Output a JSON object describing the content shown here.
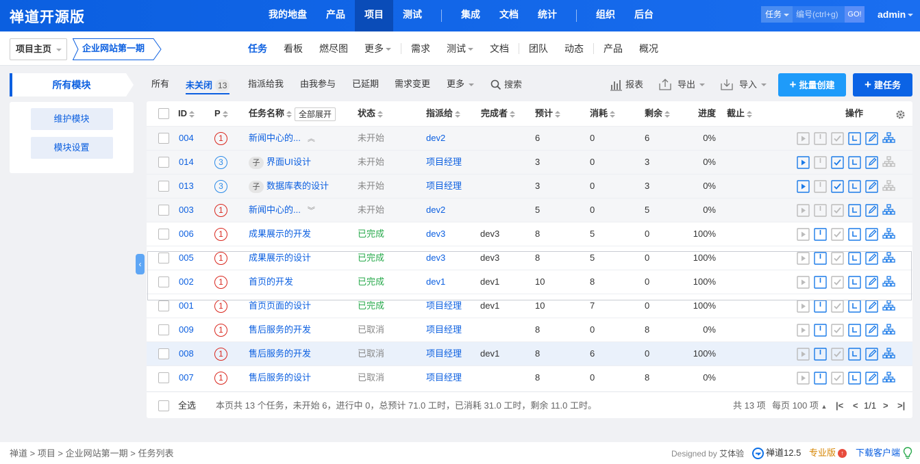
{
  "brand": "禅道开源版",
  "main_nav": [
    {
      "label": "我的地盘"
    },
    {
      "label": "产品"
    },
    {
      "label": "项目",
      "active": true
    },
    {
      "label": "测试"
    },
    {
      "label": "集成"
    },
    {
      "label": "文档"
    },
    {
      "label": "统计"
    },
    {
      "label": "组织"
    },
    {
      "label": "后台"
    }
  ],
  "search": {
    "type": "任务",
    "placeholder": "编号(ctrl+g)",
    "go": "GO!"
  },
  "user": "admin",
  "breadcrumb": {
    "home": "项目主页",
    "project": "企业网站第一期"
  },
  "sub_nav": [
    {
      "label": "任务",
      "active": true
    },
    {
      "label": "看板"
    },
    {
      "label": "燃尽图"
    },
    {
      "label": "更多"
    },
    {
      "label": "需求"
    },
    {
      "label": "测试"
    },
    {
      "label": "文档"
    },
    {
      "label": "团队"
    },
    {
      "label": "动态"
    },
    {
      "label": "产品"
    },
    {
      "label": "概况"
    }
  ],
  "sidebar": {
    "title": "所有模块",
    "buttons": [
      "维护模块",
      "模块设置"
    ]
  },
  "filters": {
    "all": "所有",
    "unclosed": "未关闭",
    "unclosed_count": "13",
    "assigned": "指派给我",
    "involved": "由我参与",
    "delayed": "已延期",
    "changed": "需求变更",
    "more": "更多",
    "search": "搜索"
  },
  "toolbar": {
    "report": "报表",
    "export": "导出",
    "import": "导入",
    "batch_create": "批量创建",
    "create": "建任务"
  },
  "table": {
    "headers": {
      "id": "ID",
      "pri": "P",
      "name": "任务名称",
      "expand_all": "全部展开",
      "status": "状态",
      "assigned": "指派给",
      "finished": "完成者",
      "estimate": "预计",
      "consumed": "消耗",
      "left": "剩余",
      "progress": "进度",
      "deadline": "截止",
      "actions": "操作"
    },
    "rows": [
      {
        "id": "004",
        "pri": "1",
        "name": "新闻中心的...",
        "status": "未开始",
        "status_kind": "wait",
        "assigned": "dev2",
        "finished": "",
        "estimate": "6",
        "consumed": "0",
        "left": "6",
        "progress": "0%",
        "parent": true,
        "expanded": true
      },
      {
        "id": "014",
        "pri": "3",
        "name": "界面UI设计",
        "status": "未开始",
        "status_kind": "wait",
        "assigned": "项目经理",
        "finished": "",
        "estimate": "3",
        "consumed": "0",
        "left": "3",
        "progress": "0%",
        "child": true,
        "child_tag": "子"
      },
      {
        "id": "013",
        "pri": "3",
        "name": "数据库表的设计",
        "status": "未开始",
        "status_kind": "wait",
        "assigned": "项目经理",
        "finished": "",
        "estimate": "3",
        "consumed": "0",
        "left": "3",
        "progress": "0%",
        "child": true,
        "child_tag": "子"
      },
      {
        "id": "003",
        "pri": "1",
        "name": "新闻中心的...",
        "status": "未开始",
        "status_kind": "wait",
        "assigned": "dev2",
        "finished": "",
        "estimate": "5",
        "consumed": "0",
        "left": "5",
        "progress": "0%",
        "parent": true,
        "expanded": false
      },
      {
        "id": "006",
        "pri": "1",
        "name": "成果展示的开发",
        "status": "已完成",
        "status_kind": "done",
        "assigned": "dev3",
        "finished": "dev3",
        "estimate": "8",
        "consumed": "5",
        "left": "0",
        "progress": "100%"
      },
      {
        "id": "005",
        "pri": "1",
        "name": "成果展示的设计",
        "status": "已完成",
        "status_kind": "done",
        "assigned": "dev3",
        "finished": "dev3",
        "estimate": "8",
        "consumed": "5",
        "left": "0",
        "progress": "100%"
      },
      {
        "id": "002",
        "pri": "1",
        "name": "首页的开发",
        "status": "已完成",
        "status_kind": "done",
        "assigned": "dev1",
        "finished": "dev1",
        "estimate": "10",
        "consumed": "8",
        "left": "0",
        "progress": "100%"
      },
      {
        "id": "001",
        "pri": "1",
        "name": "首页页面的设计",
        "status": "已完成",
        "status_kind": "done",
        "assigned": "项目经理",
        "finished": "dev1",
        "estimate": "10",
        "consumed": "7",
        "left": "0",
        "progress": "100%"
      },
      {
        "id": "009",
        "pri": "1",
        "name": "售后服务的开发",
        "status": "已取消",
        "status_kind": "cancel",
        "assigned": "项目经理",
        "finished": "",
        "estimate": "8",
        "consumed": "0",
        "left": "8",
        "progress": "0%"
      },
      {
        "id": "008",
        "pri": "1",
        "name": "售后服务的开发",
        "status": "已取消",
        "status_kind": "cancel",
        "assigned": "项目经理",
        "finished": "dev1",
        "estimate": "8",
        "consumed": "6",
        "left": "0",
        "progress": "100%",
        "highlight": true
      },
      {
        "id": "007",
        "pri": "1",
        "name": "售后服务的设计",
        "status": "已取消",
        "status_kind": "cancel",
        "assigned": "项目经理",
        "finished": "",
        "estimate": "8",
        "consumed": "0",
        "left": "8",
        "progress": "0%"
      }
    ]
  },
  "table_footer": {
    "select_all": "全选",
    "summary": "本页共 13 个任务，未开始 6，进行中 0，总预计 71.0 工时，已消耗 31.0 工时，剩余 11.0 工时。",
    "total": "共 13 项",
    "per_page": "每页 100 项",
    "page": "1/1"
  },
  "footer": {
    "breadcrumb": "禅道 > 项目 > 企业网站第一期 > 任务列表",
    "designed_by": "Designed by",
    "designer": "艾体验",
    "version": "禅道12.5",
    "edition": "专业版",
    "download": "下载客户端"
  },
  "colors": {
    "brand": "#0b5fe0",
    "accent": "#1890ff",
    "done": "#27a94b",
    "priority_high": "#d9251c",
    "priority_low": "#2a8ae8"
  }
}
